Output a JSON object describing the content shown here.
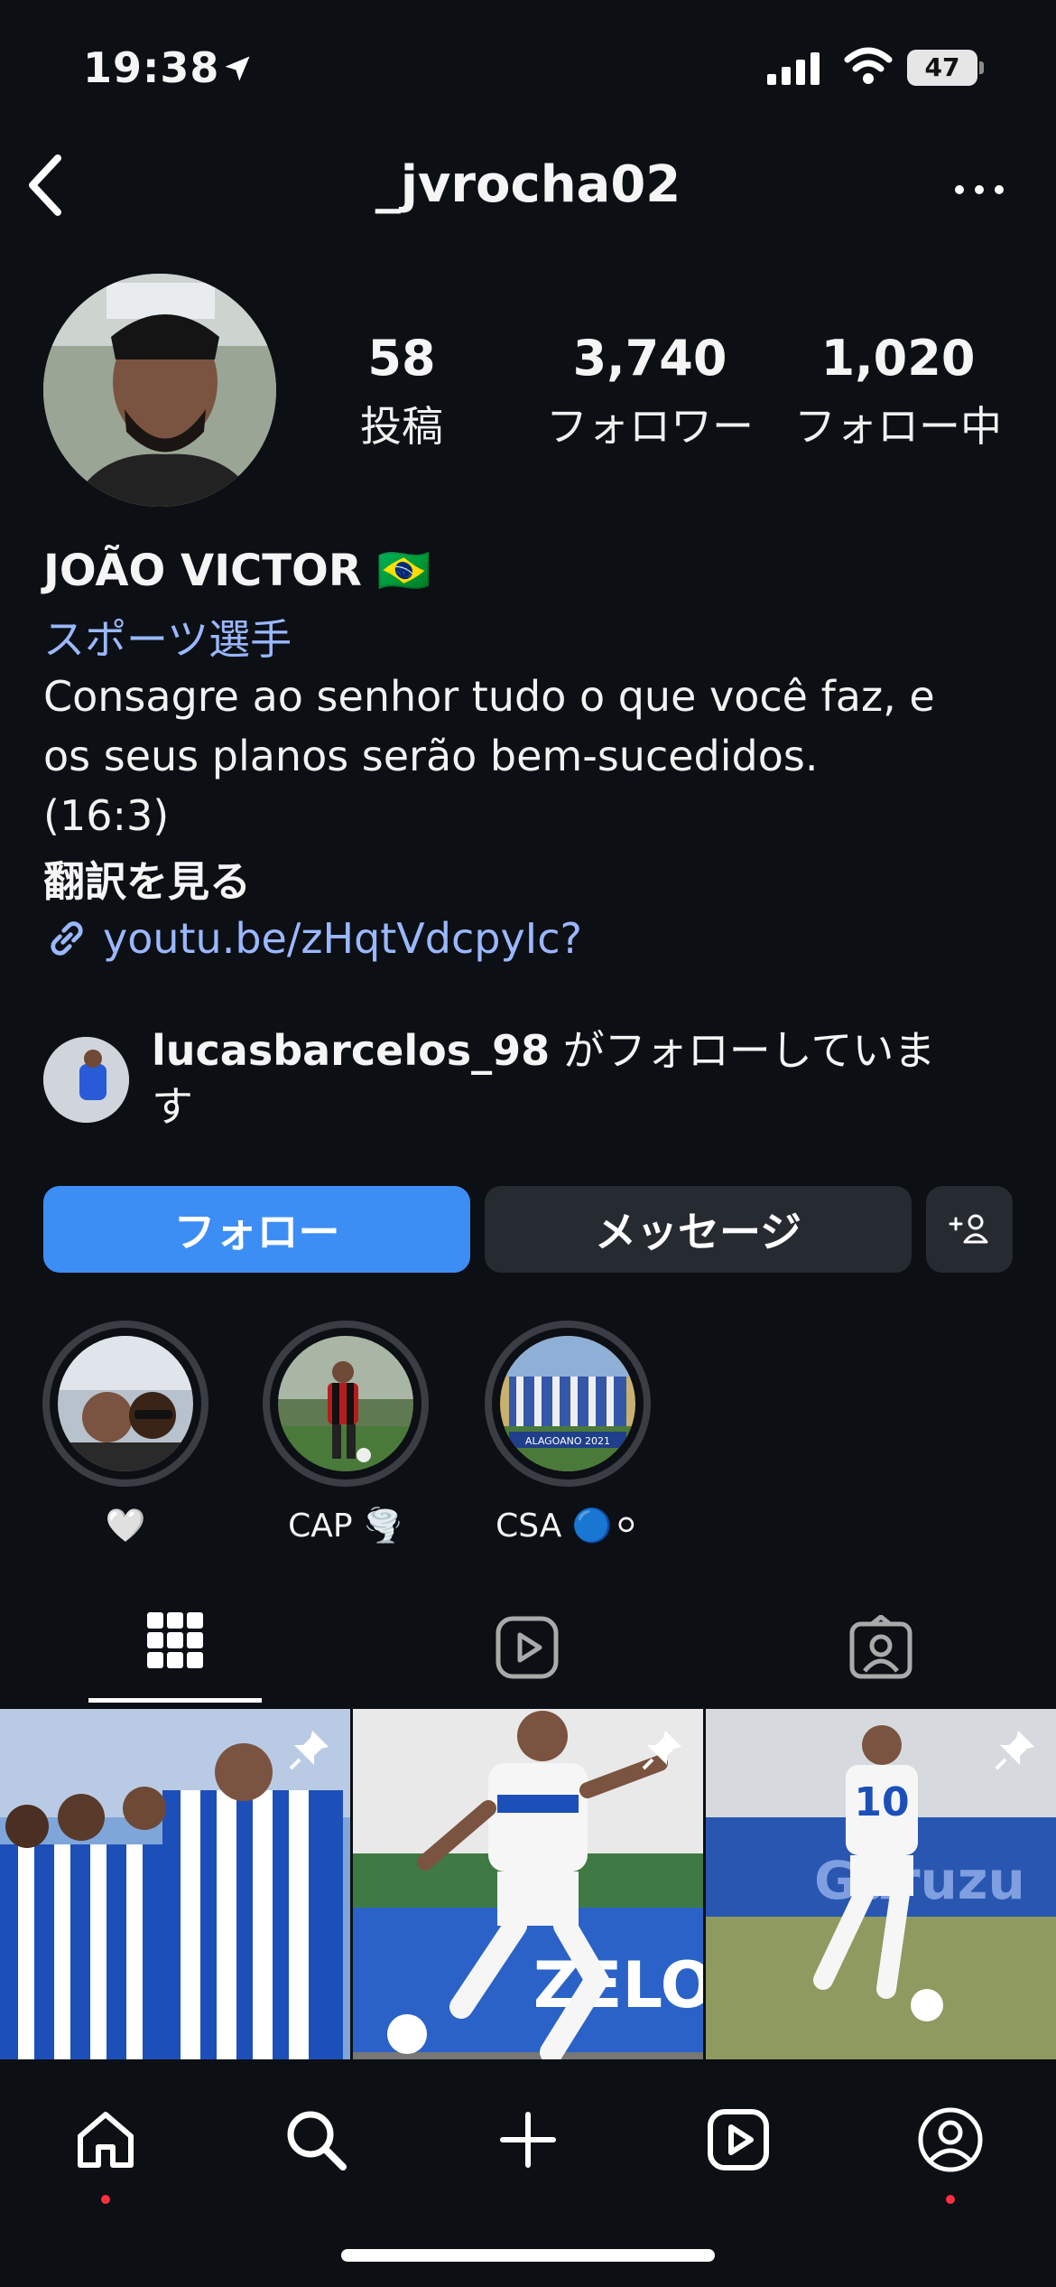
{
  "status_bar": {
    "time": "19:38",
    "battery": "47"
  },
  "header": {
    "username": "_jvrocha02"
  },
  "stats": [
    {
      "value": "58",
      "label": "投稿"
    },
    {
      "value": "3,740",
      "label": "フォロワー"
    },
    {
      "value": "1,020",
      "label": "フォロー中"
    }
  ],
  "bio": {
    "display_name": "JOÃO VICTOR 🇧🇷",
    "category": "スポーツ選手",
    "text": "Consagre ao senhor tudo o que você faz, e\nos seus planos serão bem-sucedidos.\n(16:3)",
    "translate": "翻訳を見る",
    "link": "youtu.be/zHqtVdcpyIc?"
  },
  "followed_by": {
    "user": "lucasbarcelos_98",
    "suffix": " がフォローしていま\nす"
  },
  "buttons": {
    "follow": "フォロー",
    "message": "メッセージ"
  },
  "highlights": [
    {
      "label": "🤍"
    },
    {
      "label": "CAP 🌪️"
    },
    {
      "label": "CSA 🔵⚪"
    }
  ],
  "highlight_texts": {
    "third_overlay": "ALAGOANO 2021"
  },
  "grid_posts": [
    {
      "pinned": true
    },
    {
      "pinned": true,
      "text": "ZELO"
    },
    {
      "pinned": true,
      "text": "Guruzu"
    }
  ],
  "colors": {
    "accent": "#3d8ef4",
    "link": "#9ab8ff",
    "background": "#0c0f14",
    "notification": "#ff3040"
  }
}
